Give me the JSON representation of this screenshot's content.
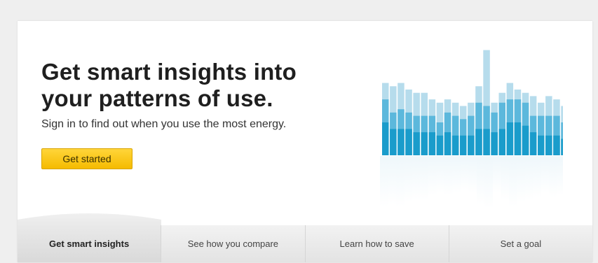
{
  "hero": {
    "headline": "Get smart insights into your patterns of use.",
    "subtitle": "Sign in to find out when you use the most energy.",
    "cta_label": "Get started"
  },
  "tabs": [
    {
      "label": "Get smart insights",
      "active": true
    },
    {
      "label": "See how you compare",
      "active": false
    },
    {
      "label": "Learn how to save",
      "active": false
    },
    {
      "label": "Set a goal",
      "active": false
    }
  ],
  "colors": {
    "accent_yellow": "#f5bb00",
    "bar_dark": "#1a9ccb",
    "bar_mid": "#5cb8dc",
    "bar_light": "#b6dcec"
  },
  "chart_data": {
    "type": "bar",
    "stacked": true,
    "values_total": [
      11,
      10.5,
      11,
      10,
      9.5,
      9.5,
      8.5,
      8,
      8.5,
      8,
      7.5,
      8,
      10.5,
      16,
      8,
      9.5,
      11,
      10,
      9.5,
      9,
      8,
      9,
      8.5,
      7.5
    ],
    "series": [
      {
        "values": [
          5,
          4,
          4,
          4,
          3.5,
          3.5,
          3.5,
          3,
          3.5,
          3,
          3,
          3,
          4,
          4,
          3.5,
          4,
          5,
          5,
          4.5,
          3.5,
          3,
          3,
          3,
          2.5
        ]
      },
      {
        "values": [
          8.5,
          6.5,
          7,
          6.5,
          6,
          6,
          6,
          5,
          6.5,
          6,
          5.5,
          6,
          8,
          7.5,
          6.5,
          8,
          8.5,
          8.5,
          8,
          6,
          6,
          6,
          6,
          5
        ]
      }
    ]
  }
}
